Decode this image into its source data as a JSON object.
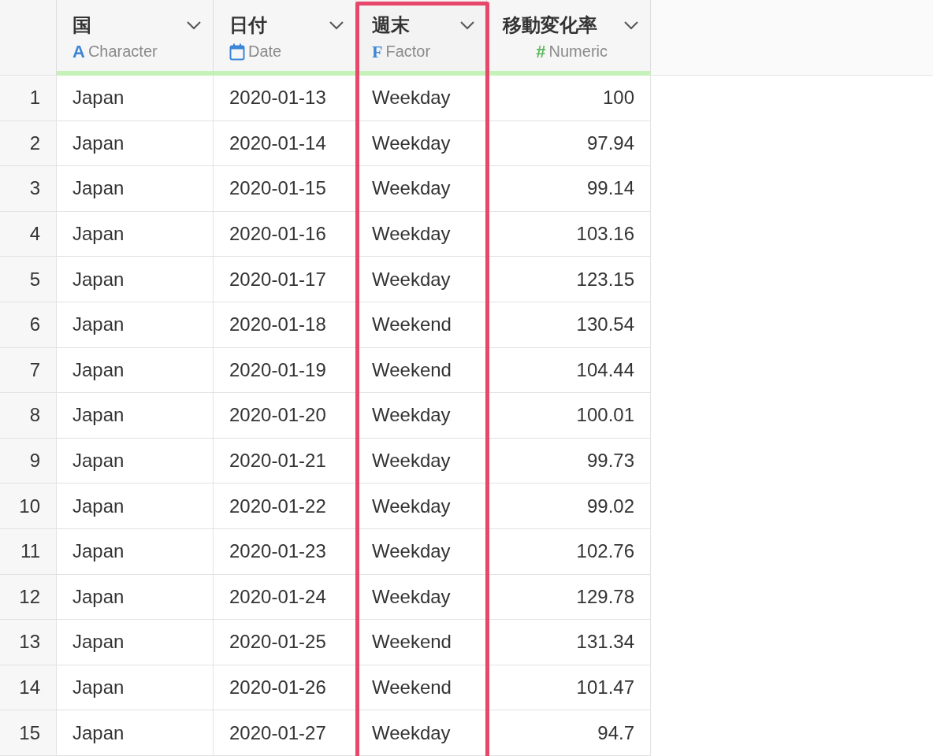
{
  "table": {
    "columns": [
      {
        "name": "国",
        "type_icon": "A",
        "type_label": "Character",
        "kind": "character",
        "highlighted": false
      },
      {
        "name": "日付",
        "type_label": "Date",
        "kind": "date",
        "highlighted": false
      },
      {
        "name": "週末",
        "type_icon": "F",
        "type_label": "Factor",
        "kind": "factor",
        "highlighted": true
      },
      {
        "name": "移動変化率",
        "type_icon": "#",
        "type_label": "Numeric",
        "kind": "numeric",
        "highlighted": false
      }
    ],
    "rows": [
      {
        "number": "1",
        "cells": [
          "Japan",
          "2020-01-13",
          "Weekday",
          "100"
        ]
      },
      {
        "number": "2",
        "cells": [
          "Japan",
          "2020-01-14",
          "Weekday",
          "97.94"
        ]
      },
      {
        "number": "3",
        "cells": [
          "Japan",
          "2020-01-15",
          "Weekday",
          "99.14"
        ]
      },
      {
        "number": "4",
        "cells": [
          "Japan",
          "2020-01-16",
          "Weekday",
          "103.16"
        ]
      },
      {
        "number": "5",
        "cells": [
          "Japan",
          "2020-01-17",
          "Weekday",
          "123.15"
        ]
      },
      {
        "number": "6",
        "cells": [
          "Japan",
          "2020-01-18",
          "Weekend",
          "130.54"
        ]
      },
      {
        "number": "7",
        "cells": [
          "Japan",
          "2020-01-19",
          "Weekend",
          "104.44"
        ]
      },
      {
        "number": "8",
        "cells": [
          "Japan",
          "2020-01-20",
          "Weekday",
          "100.01"
        ]
      },
      {
        "number": "9",
        "cells": [
          "Japan",
          "2020-01-21",
          "Weekday",
          "99.73"
        ]
      },
      {
        "number": "10",
        "cells": [
          "Japan",
          "2020-01-22",
          "Weekday",
          "99.02"
        ]
      },
      {
        "number": "11",
        "cells": [
          "Japan",
          "2020-01-23",
          "Weekday",
          "102.76"
        ]
      },
      {
        "number": "12",
        "cells": [
          "Japan",
          "2020-01-24",
          "Weekday",
          "129.78"
        ]
      },
      {
        "number": "13",
        "cells": [
          "Japan",
          "2020-01-25",
          "Weekend",
          "131.34"
        ]
      },
      {
        "number": "14",
        "cells": [
          "Japan",
          "2020-01-26",
          "Weekend",
          "101.47"
        ]
      },
      {
        "number": "15",
        "cells": [
          "Japan",
          "2020-01-27",
          "Weekday",
          "94.7"
        ]
      }
    ]
  }
}
